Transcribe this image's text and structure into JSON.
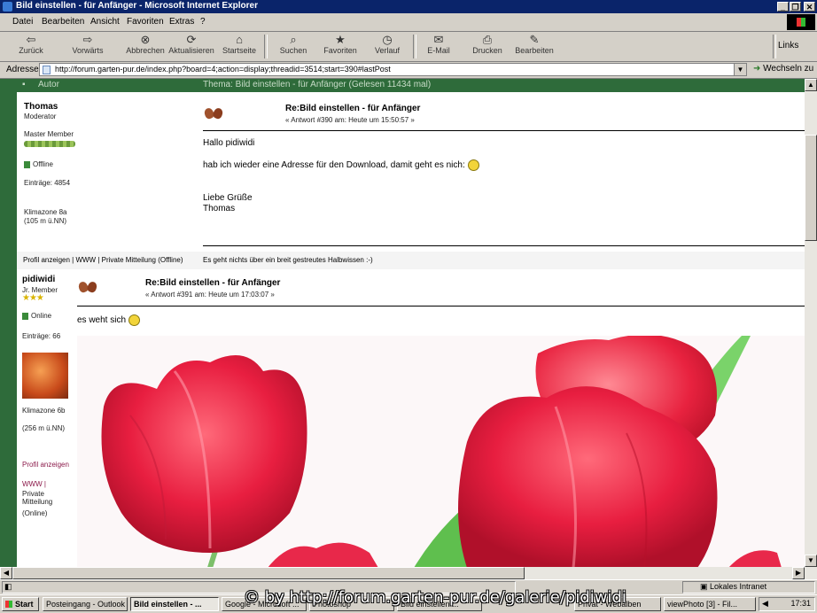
{
  "window": {
    "title": "Bild einstellen - für Anfänger - Microsoft Internet Explorer",
    "min_label": "_",
    "max_label": "❐",
    "close_label": "✕"
  },
  "menu": [
    "Datei",
    "Bearbeiten",
    "Ansicht",
    "Favoriten",
    "Extras",
    "?"
  ],
  "toolbar": {
    "back": "Zurück",
    "forward": "Vorwärts",
    "stop": "Abbrechen",
    "refresh": "Aktualisieren",
    "home": "Startseite",
    "search": "Suchen",
    "favorites": "Favoriten",
    "history": "Verlauf",
    "mail": "E-Mail",
    "print": "Drucken",
    "edit": "Bearbeiten",
    "links": "Links"
  },
  "address": {
    "label": "Adresse",
    "value": "http://forum.garten-pur.de/index.php?board=4;action=display;threadid=3514;start=390#lastPost",
    "go": "Wechseln zu"
  },
  "forum": {
    "header_author": "Autor",
    "header_thread": "Thema: Bild einstellen - für Anfänger (Gelesen 11434 mal)",
    "post1": {
      "author": "Thomas",
      "role": "Moderator",
      "rank": "Master Member",
      "status": "Offline",
      "posts": "Einträge: 4854",
      "climate": "Klimazone 8a",
      "location": "(105 m ü.NN)",
      "title": "Re:Bild einstellen - für Anfänger",
      "meta": "« Antwort #390 am: Heute um 15:50:57 »",
      "greeting": "Hallo pidiwidi",
      "body": "hab ich wieder eine Adresse für den Download, damit geht es nich:",
      "closing1": "Liebe Grüße",
      "closing2": "Thomas",
      "footer_left": "Profil anzeigen | WWW | Private Mitteilung (Offline)",
      "footer_sig": "Es geht nichts über ein breit gestreutes Halbwissen :-)"
    },
    "post2": {
      "author": "pidiwidi",
      "role": "Jr. Member",
      "status": "Online",
      "posts": "Einträge: 66",
      "climate": "Klimazone 6b",
      "location": "(256 m ü.NN)",
      "title": "Re:Bild einstellen - für Anfänger",
      "meta": "« Antwort #391 am: Heute um 17:03:07 »",
      "body": "es weht sich",
      "profile": "Profil anzeigen",
      "www": "WWW |",
      "pm": "Private Mitteilung",
      "online": "(Online)"
    }
  },
  "status": {
    "zone": "Lokales Intranet"
  },
  "taskbar": {
    "start": "Start",
    "tasks": [
      "Posteingang - Outlook Express",
      "Bild einstellen - ...",
      "Google - Microsoft ...",
      "Photoshop",
      "Bild einstellen ...",
      "Privat - Webalben",
      "viewPhoto [3] - Fil..."
    ],
    "clock": "17:31"
  },
  "watermark": "© by http://forum.garten-pur.de/galerie/pidiwidi"
}
